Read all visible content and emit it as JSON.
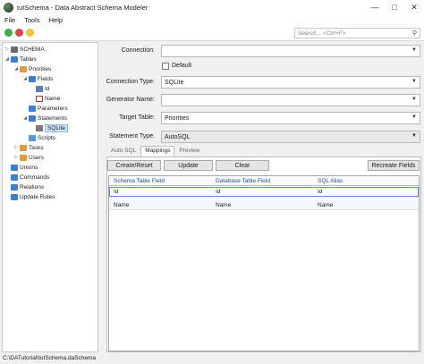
{
  "window": {
    "title": "tutSchema - Data Abstract Schema Modeler"
  },
  "menu": [
    "File",
    "Tools",
    "Help"
  ],
  "search": {
    "placeholder": "Search... <Ctrl+F>"
  },
  "tree": {
    "schema": "SCHEMA",
    "tables": "Tables",
    "priorities": "Priorities",
    "fields": "Fields",
    "field_id": "Id",
    "field_name": "Name",
    "parameters": "Parameters",
    "statements": "Statements",
    "sqlite": "SQLite",
    "scripts": "Scripts",
    "tasks": "Tasks",
    "users": "Users",
    "unions": "Unions",
    "commands": "Commands",
    "relations": "Relations",
    "update_rules": "Update Rules"
  },
  "form": {
    "connection_label": "Connection:",
    "connection_value": "",
    "default_label": "Default",
    "connection_type_label": "Connection Type:",
    "connection_type_value": "SQLite",
    "generator_name_label": "Generator Name:",
    "generator_name_value": "",
    "target_table_label": "Target Table:",
    "target_table_value": "Priorities",
    "statement_type_label": "Statement Type:",
    "statement_type_value": "AutoSQL"
  },
  "tabs": [
    "Auto SQL",
    "Mappings",
    "Preview"
  ],
  "buttons": {
    "create_reset": "Create/Reset",
    "update": "Update",
    "clear": "Clear",
    "recreate_fields": "Recreate Fields"
  },
  "grid": {
    "headers": [
      "Schema Table Field",
      "Database Table Field",
      "SQL Alias"
    ],
    "rows": [
      [
        "Id",
        "Id",
        "Id"
      ],
      [
        "Name",
        "Name",
        "Name"
      ]
    ]
  },
  "status": {
    "path": "C:\\DATutorial\\tutSchema.daSchema"
  },
  "colors": {
    "accent": "#3a7fd0",
    "selection": "#cde4f7"
  }
}
